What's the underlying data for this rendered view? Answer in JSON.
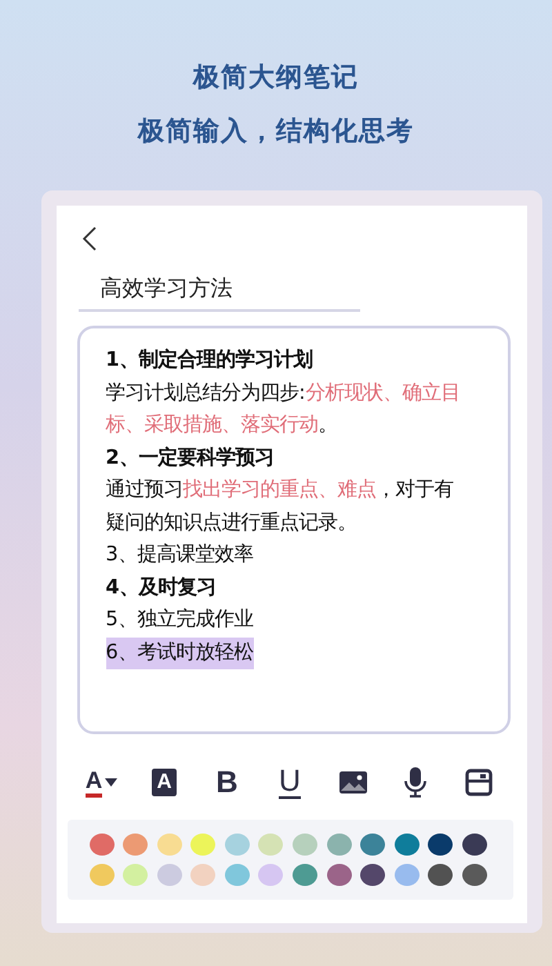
{
  "headline": [
    "极简大纲笔记",
    "极简输入，结构化思考"
  ],
  "note": {
    "title": "高效学习方法",
    "lines": [
      {
        "kind": "heading",
        "selected": false,
        "segments": [
          {
            "text": "1、制定合理的学习计划",
            "marked": false
          }
        ]
      },
      {
        "kind": "body",
        "selected": false,
        "segments": [
          {
            "text": "学习计划总结分为四步:",
            "marked": false
          },
          {
            "text": "分析现状、确立目标、采取措施、落实行动",
            "marked": true
          },
          {
            "text": "。",
            "marked": false
          }
        ]
      },
      {
        "kind": "heading",
        "selected": false,
        "segments": [
          {
            "text": "2、一定要科学预习",
            "marked": false
          }
        ]
      },
      {
        "kind": "body",
        "selected": false,
        "segments": [
          {
            "text": "通过预习",
            "marked": false
          },
          {
            "text": "找出学习的重点、难点",
            "marked": true
          },
          {
            "text": "，对于有疑问的知识点进行重点记录。",
            "marked": false
          }
        ]
      },
      {
        "kind": "body",
        "selected": false,
        "segments": [
          {
            "text": "3、提高课堂效率",
            "marked": false
          }
        ]
      },
      {
        "kind": "heading",
        "selected": false,
        "segments": [
          {
            "text": "4、及时复习",
            "marked": false
          }
        ]
      },
      {
        "kind": "body",
        "selected": false,
        "segments": [
          {
            "text": "5、独立完成作业",
            "marked": false
          }
        ]
      },
      {
        "kind": "body",
        "selected": true,
        "segments": [
          {
            "text": "6、考试时放轻松",
            "marked": false
          }
        ]
      }
    ]
  },
  "toolbar": [
    {
      "kind": "text-color",
      "label": "A"
    },
    {
      "kind": "highlight",
      "label": "A"
    },
    {
      "kind": "bold",
      "label": "B"
    },
    {
      "kind": "underline",
      "label": "U"
    },
    {
      "kind": "image"
    },
    {
      "kind": "mic"
    },
    {
      "kind": "save"
    }
  ],
  "palette": [
    {
      "color": "#e06b66"
    },
    {
      "color": "#ec9a73"
    },
    {
      "color": "#f8dc92"
    },
    {
      "color": "#ecf45a"
    },
    {
      "color": "#a6d2df"
    },
    {
      "color": "#d5e2b4"
    },
    {
      "color": "#b6d0bc"
    },
    {
      "color": "#8bb3ad"
    },
    {
      "color": "#3c8399"
    },
    {
      "color": "#0f7d9b"
    },
    {
      "color": "#0a3b6b"
    },
    {
      "color": "#3a3a55"
    },
    {
      "color": "#f0c95e"
    },
    {
      "color": "#d3f0a0"
    },
    {
      "color": "#cccbe0"
    },
    {
      "color": "#f2d2c0"
    },
    {
      "color": "#80c7dc"
    },
    {
      "color": "#d6c6f2"
    },
    {
      "color": "#4e9b93"
    },
    {
      "color": "#9b6489"
    },
    {
      "color": "#54476a"
    },
    {
      "color": "#98bbee"
    },
    {
      "color": "#525252"
    },
    {
      "color": "#5a5a5a"
    }
  ]
}
